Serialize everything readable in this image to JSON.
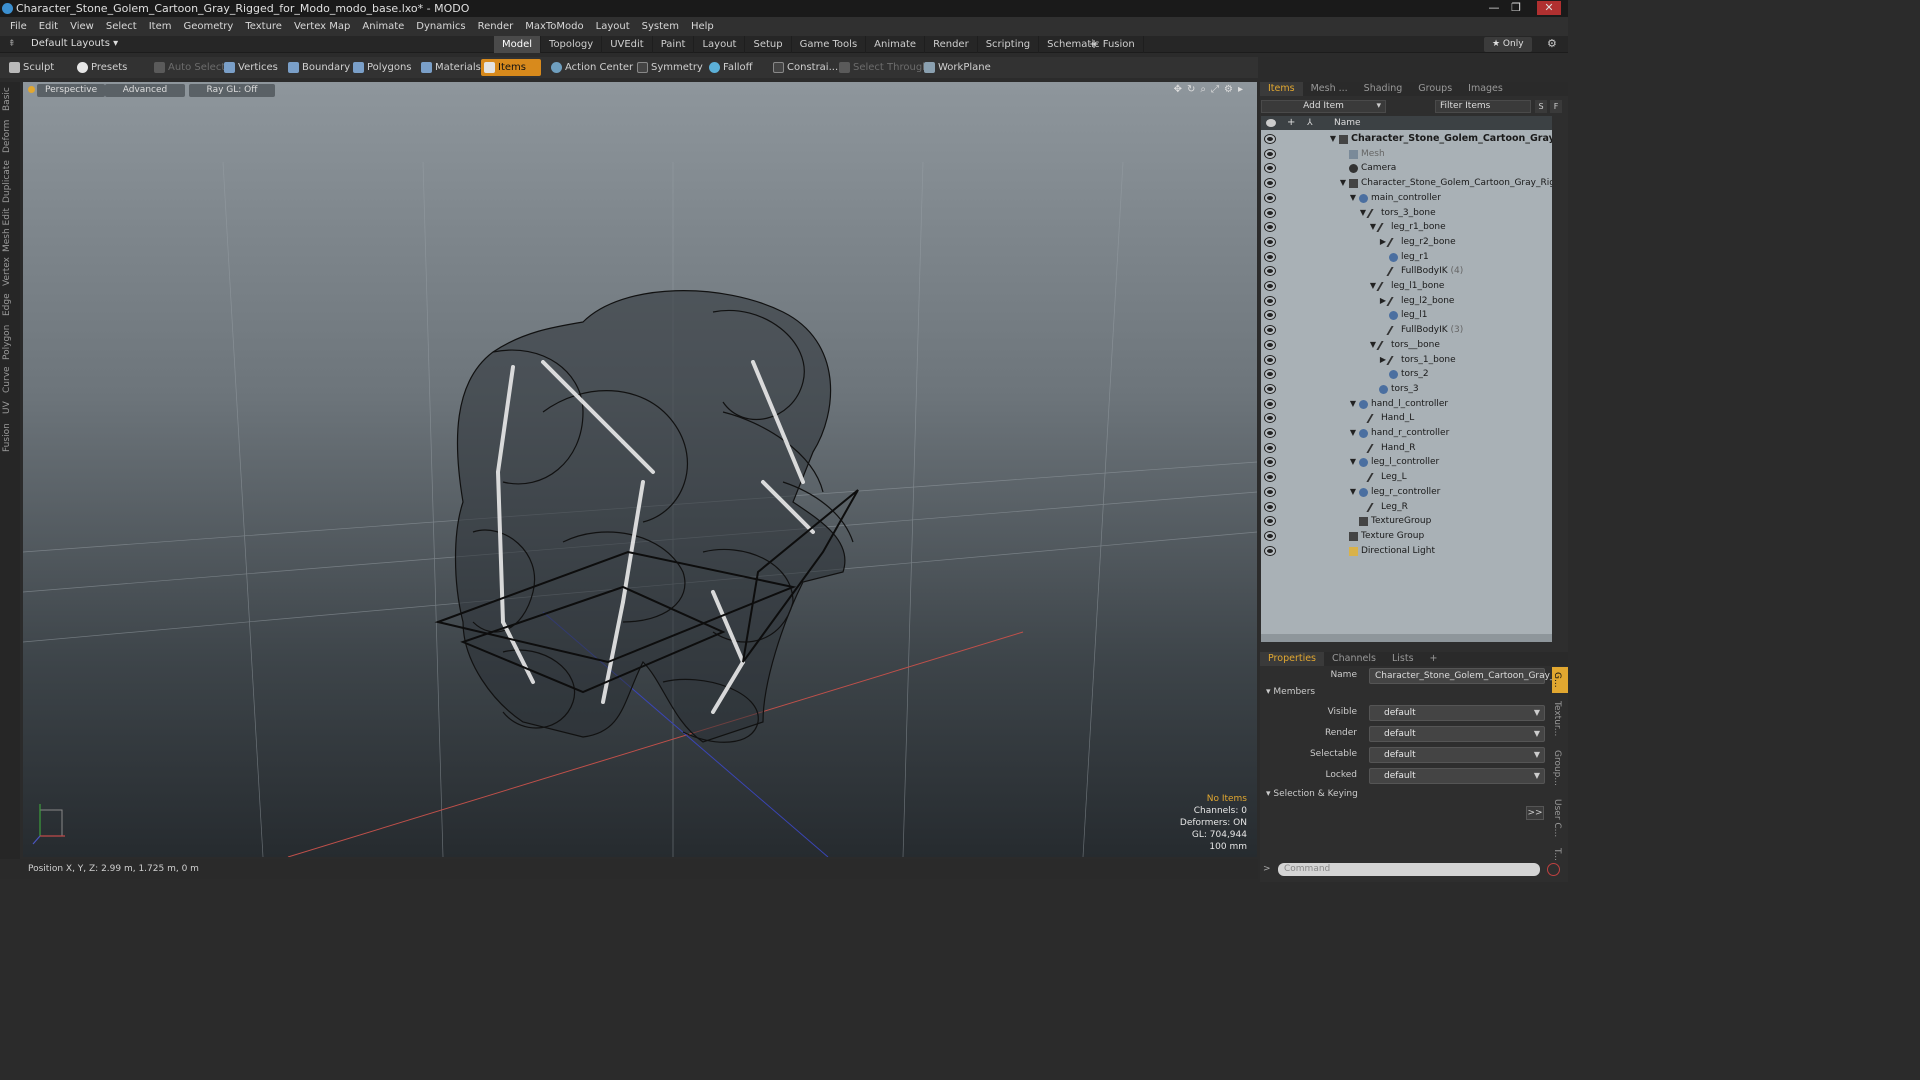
{
  "window": {
    "title": "Character_Stone_Golem_Cartoon_Gray_Rigged_for_Modo_modo_base.lxo* - MODO",
    "minimize": "—",
    "maximize": "❐",
    "close": "✕"
  },
  "menu": [
    "File",
    "Edit",
    "View",
    "Select",
    "Item",
    "Geometry",
    "Texture",
    "Vertex Map",
    "Animate",
    "Dynamics",
    "Render",
    "MaxToModo",
    "Layout",
    "System",
    "Help"
  ],
  "layoutbar": {
    "layouts_label": "Default Layouts ▾",
    "tabs": [
      "Model",
      "Topology",
      "UVEdit",
      "Paint",
      "Layout",
      "Setup",
      "Game Tools",
      "Animate",
      "Render",
      "Scripting",
      "Schematic Fusion"
    ],
    "active_tab": "Model",
    "add": "+",
    "only_label": "★ Only",
    "gear": "⚙"
  },
  "toolbar": {
    "sculpt": "Sculpt",
    "presets": "Presets",
    "auto_select": "Auto Select",
    "vertices": "Vertices",
    "boundary": "Boundary",
    "polygons": "Polygons",
    "materials": "Materials",
    "items": "Items",
    "action_center": "Action Center",
    "symmetry": "Symmetry",
    "falloff": "Falloff",
    "constraints": "Constrai...",
    "select_through": "Select Through",
    "workplane": "WorkPlane"
  },
  "left_tabs": [
    "Basic",
    "Deform",
    "Duplicate",
    "Mesh Edit",
    "Vertex",
    "Edge",
    "Polygon",
    "Curve",
    "UV",
    "Fusion"
  ],
  "viewport": {
    "view": "Perspective",
    "advanced": "Advanced",
    "raygl": "Ray GL: Off",
    "info": {
      "no_items": "No Items",
      "channels": "Channels: 0",
      "deformers": "Deformers: ON",
      "gl": "GL: 704,944",
      "scale": "100 mm"
    }
  },
  "status": "Position X, Y, Z:   2.99 m, 1.725 m, 0 m",
  "items_panel": {
    "tabs": [
      "Items",
      "Mesh ...",
      "Shading",
      "Groups",
      "Images"
    ],
    "add_item": "Add Item",
    "filter_items": "Filter Items",
    "s_btn": "S",
    "f_btn": "F",
    "name_header": "Name",
    "rows": [
      {
        "label": "Character_Stone_Golem_Cartoon_Gray ...",
        "depth": 0,
        "tog": "▼",
        "icon": "scene",
        "bold": true
      },
      {
        "label": "Mesh",
        "depth": 1,
        "tog": "",
        "icon": "mesh",
        "dim": true
      },
      {
        "label": "Camera",
        "depth": 1,
        "tog": "",
        "icon": "camera"
      },
      {
        "label": "Character_Stone_Golem_Cartoon_Gray_Rig ...",
        "depth": 1,
        "tog": "▼",
        "icon": "group"
      },
      {
        "label": "main_controller",
        "depth": 2,
        "tog": "▼",
        "icon": "locator"
      },
      {
        "label": "tors_3_bone",
        "depth": 3,
        "tog": "▼",
        "icon": "bone"
      },
      {
        "label": "leg_r1_bone",
        "depth": 4,
        "tog": "▼",
        "icon": "bone"
      },
      {
        "label": "leg_r2_bone",
        "depth": 5,
        "tog": "▶",
        "icon": "bone"
      },
      {
        "label": "leg_r1",
        "depth": 5,
        "tog": "",
        "icon": "locator"
      },
      {
        "label": "FullBodyIK",
        "suffix": " (4)",
        "depth": 5,
        "tog": "",
        "icon": "bone"
      },
      {
        "label": "leg_l1_bone",
        "depth": 4,
        "tog": "▼",
        "icon": "bone"
      },
      {
        "label": "leg_l2_bone",
        "depth": 5,
        "tog": "▶",
        "icon": "bone"
      },
      {
        "label": "leg_l1",
        "depth": 5,
        "tog": "",
        "icon": "locator"
      },
      {
        "label": "FullBodyIK",
        "suffix": " (3)",
        "depth": 5,
        "tog": "",
        "icon": "bone"
      },
      {
        "label": "tors__bone",
        "depth": 4,
        "tog": "▼",
        "icon": "bone"
      },
      {
        "label": "tors_1_bone",
        "depth": 5,
        "tog": "▶",
        "icon": "bone"
      },
      {
        "label": "tors_2",
        "depth": 5,
        "tog": "",
        "icon": "locator"
      },
      {
        "label": "tors_3",
        "depth": 4,
        "tog": "",
        "icon": "locator"
      },
      {
        "label": "hand_l_controller",
        "depth": 2,
        "tog": "▼",
        "icon": "locator"
      },
      {
        "label": "Hand_L",
        "depth": 3,
        "tog": "",
        "icon": "bone"
      },
      {
        "label": "hand_r_controller",
        "depth": 2,
        "tog": "▼",
        "icon": "locator"
      },
      {
        "label": "Hand_R",
        "depth": 3,
        "tog": "",
        "icon": "bone"
      },
      {
        "label": "leg_l_controller",
        "depth": 2,
        "tog": "▼",
        "icon": "locator"
      },
      {
        "label": "Leg_L",
        "depth": 3,
        "tog": "",
        "icon": "bone"
      },
      {
        "label": "leg_r_controller",
        "depth": 2,
        "tog": "▼",
        "icon": "locator"
      },
      {
        "label": "Leg_R",
        "depth": 3,
        "tog": "",
        "icon": "bone"
      },
      {
        "label": "TextureGroup",
        "depth": 2,
        "tog": "",
        "icon": "group"
      },
      {
        "label": "Texture Group",
        "depth": 1,
        "tog": "",
        "icon": "group"
      },
      {
        "label": "Directional Light",
        "depth": 1,
        "tog": "",
        "icon": "light"
      }
    ]
  },
  "properties_panel": {
    "tabs": [
      "Properties",
      "Channels",
      "Lists",
      "+"
    ],
    "name_label": "Name",
    "name_value": "Character_Stone_Golem_Cartoon_Gray_R",
    "members_label": "Members",
    "fields": [
      {
        "label": "Visible",
        "value": "default"
      },
      {
        "label": "Render",
        "value": "default"
      },
      {
        "label": "Selectable",
        "value": "default"
      },
      {
        "label": "Locked",
        "value": "default"
      }
    ],
    "selection_keying": "Selection & Keying",
    "expand_btn": ">>",
    "side_tabs": [
      "G...",
      "Textur...",
      "Group...",
      "User C...",
      "T..."
    ],
    "command_placeholder": "Command"
  },
  "colors": {
    "accent": "#e1a730",
    "active_tool": "#d88a1c",
    "tree_bg": "#a9b1b6"
  }
}
